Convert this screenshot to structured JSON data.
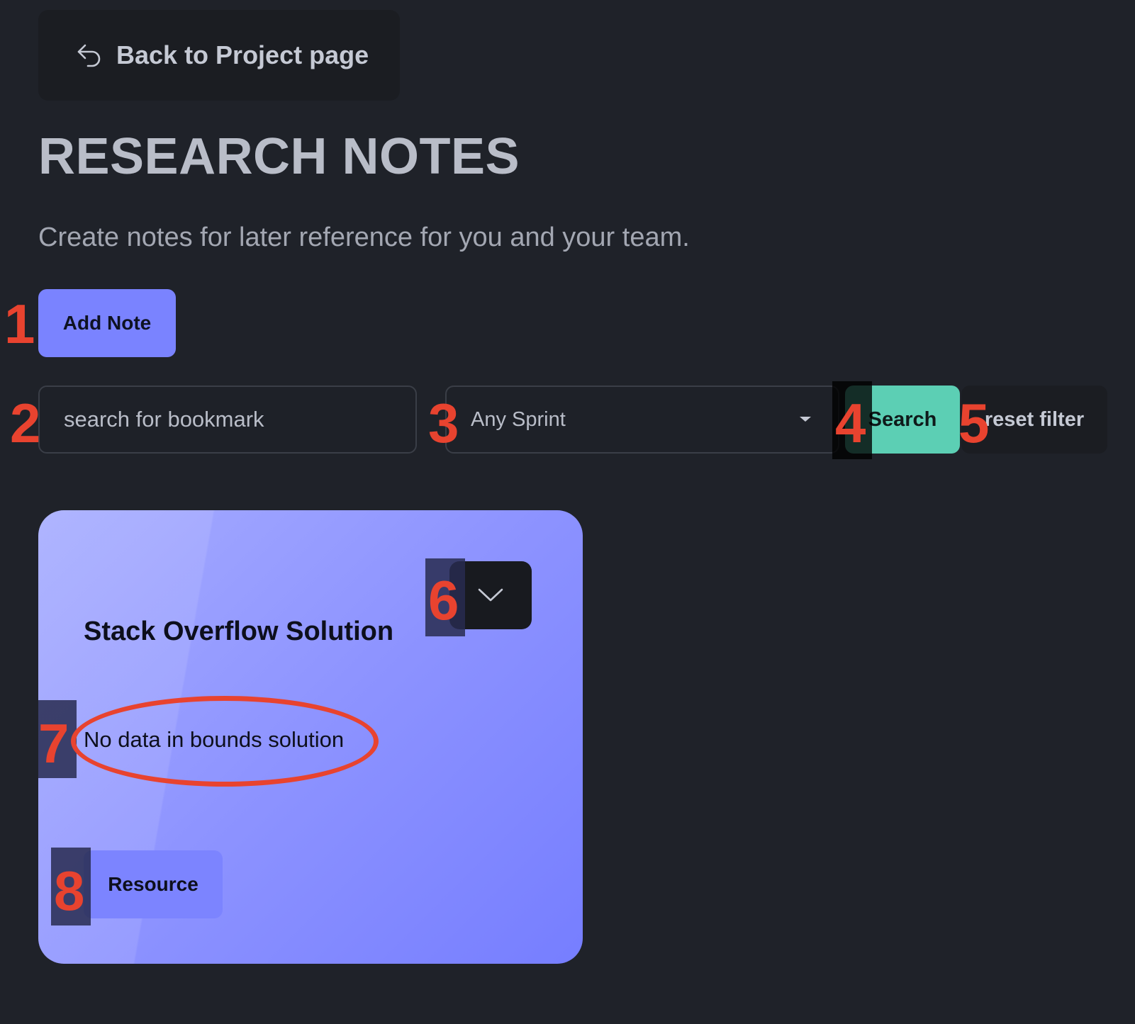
{
  "back_link": {
    "label": "Back to Project page",
    "icon": "undo-arrow-icon"
  },
  "page": {
    "title": "RESEARCH NOTES",
    "subtitle": "Create notes for later reference for you and your team."
  },
  "toolbar": {
    "add_note_label": "Add Note",
    "search_placeholder": "search for bookmark",
    "sprint_select_value": "Any Sprint",
    "search_label": "Search",
    "reset_label": "reset filter"
  },
  "notes": [
    {
      "title": "Stack Overflow Solution",
      "body": "No data in bounds solution",
      "tag": "Resource",
      "toggle_icon": "chevron-down-icon"
    }
  ],
  "annotations": {
    "markers": [
      "1",
      "2",
      "3",
      "4",
      "5",
      "6",
      "7",
      "8"
    ],
    "color": "#e8432f"
  },
  "colors": {
    "background": "#1f2229",
    "accent": "#7a83ff",
    "search_button": "#5ccfb4",
    "card_gradient_start": "#a6acff",
    "card_gradient_end": "#767eff"
  }
}
